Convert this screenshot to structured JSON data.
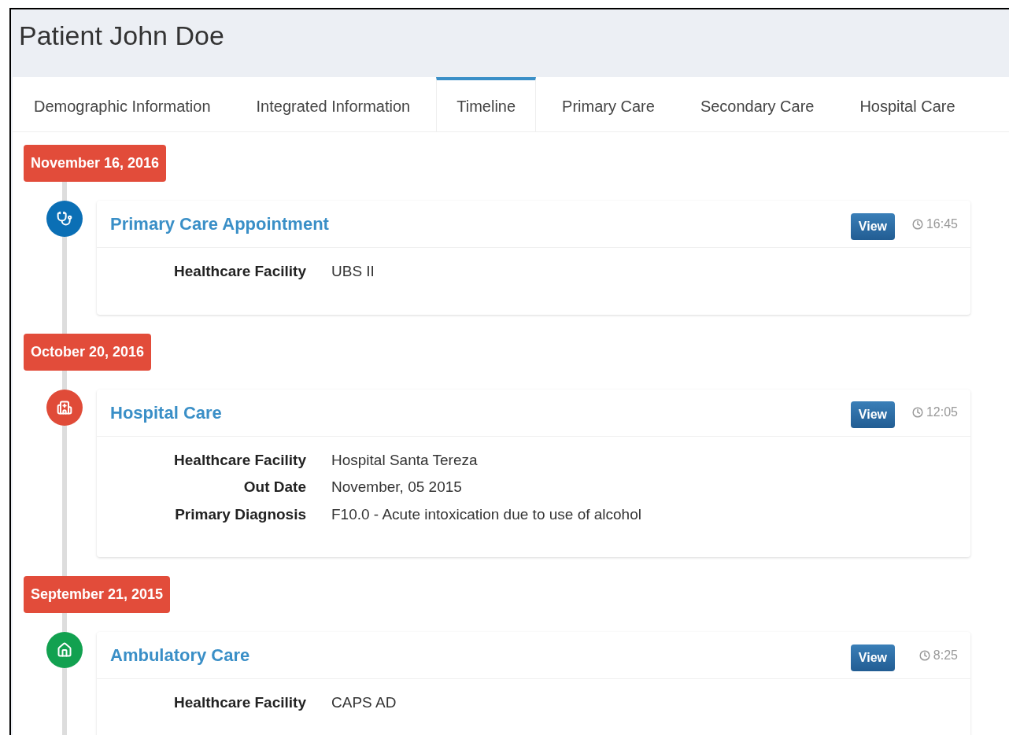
{
  "title": "Patient John Doe",
  "tabs": [
    {
      "label": "Demographic Information",
      "selected": false
    },
    {
      "label": "Integrated Information",
      "selected": false
    },
    {
      "label": "Timeline",
      "selected": true
    },
    {
      "label": "Primary Care",
      "selected": false
    },
    {
      "label": "Secondary Care",
      "selected": false
    },
    {
      "label": "Hospital Care",
      "selected": false
    }
  ],
  "timeline": [
    {
      "date": "November 16, 2016",
      "events": [
        {
          "kind": "stethoscope",
          "color": "#0b6fb5",
          "title": "Primary Care Appointment",
          "button": "View",
          "time": "16:45",
          "fields": [
            {
              "label": "Healthcare Facility",
              "value": "UBS II"
            }
          ]
        }
      ]
    },
    {
      "date": "October 20, 2016",
      "events": [
        {
          "kind": "hospital",
          "color": "#e04b38",
          "title": "Hospital Care",
          "button": "View",
          "time": "12:05",
          "fields": [
            {
              "label": "Healthcare Facility",
              "value": "Hospital Santa Tereza"
            },
            {
              "label": "Out Date",
              "value": "November, 05 2015"
            },
            {
              "label": "Primary Diagnosis",
              "value": "F10.0 - Acute intoxication due to use of alcohol"
            }
          ]
        }
      ]
    },
    {
      "date": "September 21, 2015",
      "events": [
        {
          "kind": "home",
          "color": "#12a150",
          "title": "Ambulatory Care",
          "button": "View",
          "time": "8:25",
          "fields": [
            {
              "label": "Healthcare Facility",
              "value": "CAPS AD"
            }
          ]
        }
      ]
    }
  ]
}
